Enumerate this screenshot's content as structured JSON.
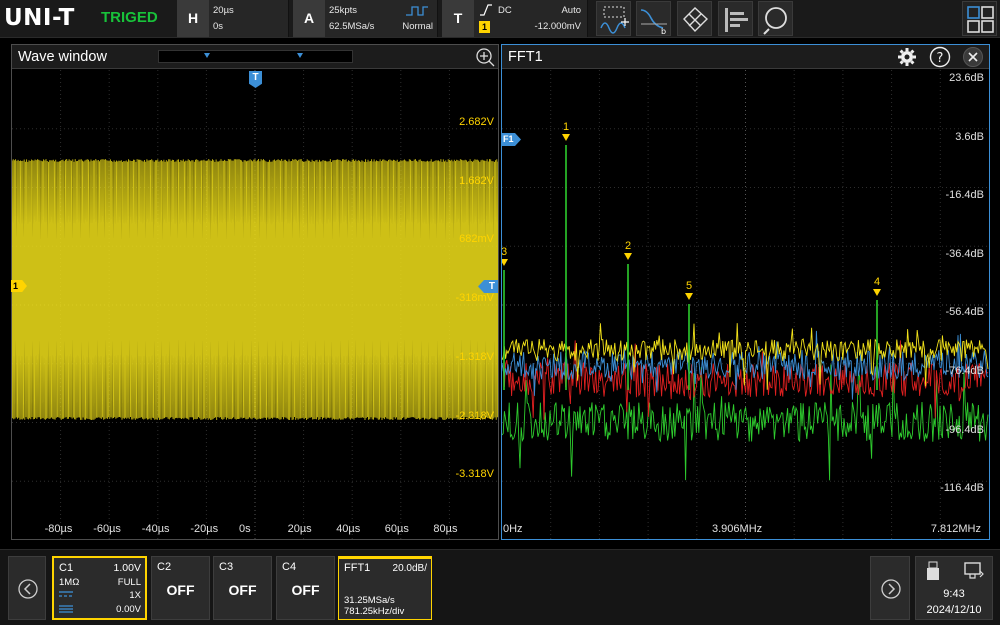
{
  "topbar": {
    "logo": "UNI-T",
    "trigger_status": "TRIGED",
    "horizontal": {
      "letter": "H",
      "time_base": "20µs",
      "offset": "0s"
    },
    "acquire": {
      "letter": "A",
      "memory_depth": "25kpts",
      "sample_rate": "62.5MSa/s",
      "mode": "Normal"
    },
    "trigger": {
      "letter": "T",
      "coupling": "DC",
      "sweep": "Auto",
      "source": "1",
      "level": "-12.000mV"
    }
  },
  "wave_window": {
    "title": "Wave window",
    "trigger_marker": "T",
    "channel_marker": "1",
    "right_marker": "T",
    "y_labels": [
      "2.682V",
      "1.682V",
      "682mV",
      "-318mV",
      "-1.318V",
      "-2.318V",
      "-3.318V"
    ],
    "x_labels": [
      "-80µs",
      "-60µs",
      "-40µs",
      "-20µs",
      "0s",
      "20µs",
      "40µs",
      "60µs",
      "80µs"
    ]
  },
  "fft_window": {
    "title": "FFT1",
    "ref_marker": "F1",
    "y_labels": [
      "23.6dB",
      "3.6dB",
      "-16.4dB",
      "-36.4dB",
      "-56.4dB",
      "-76.4dB",
      "-96.4dB",
      "-116.4dB"
    ],
    "x_labels": [
      "0Hz",
      "3.906MHz",
      "7.812MHz"
    ],
    "peak_markers": [
      "1",
      "2",
      "3",
      "4",
      "5"
    ]
  },
  "bottombar": {
    "c1": {
      "name": "C1",
      "scale": "1.00V",
      "impedance": "1MΩ",
      "bandwidth": "FULL",
      "probe": "1X",
      "offset": "0.00V"
    },
    "c2": {
      "name": "C2",
      "state": "OFF"
    },
    "c3": {
      "name": "C3",
      "state": "OFF"
    },
    "c4": {
      "name": "C4",
      "state": "OFF"
    },
    "fft": {
      "name": "FFT1",
      "scale": "20.0dB/",
      "sample_rate": "31.25MSa/s",
      "resolution": "781.25kHz/div"
    },
    "time": "9:43",
    "date": "2024/12/10"
  },
  "colors": {
    "ch1": "#f2e21a",
    "fft_blue": "#3c8fd6",
    "green": "#2ecc2e",
    "red": "#e02020",
    "marker_yellow": "#ffd400"
  }
}
